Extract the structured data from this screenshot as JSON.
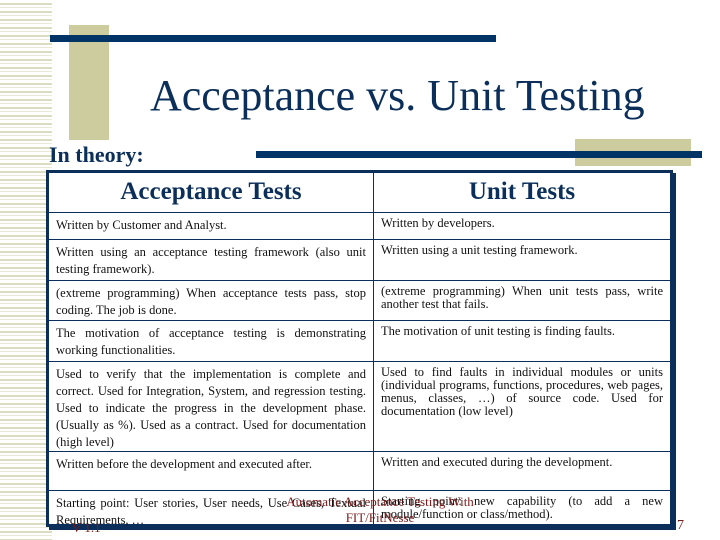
{
  "slide": {
    "title": "Acceptance vs. Unit Testing",
    "subtitle": "In theory:",
    "footer": {
      "center_line1": "Automatic Acceptance Testing With",
      "center_line2": "FIT/FitNesse",
      "left": "V 1.1",
      "page_number": "7"
    },
    "colors": {
      "navy": "#0b2f5a",
      "olive": "#cccc9e",
      "footer_text": "#7a1a1a"
    }
  },
  "table": {
    "headers": [
      "Acceptance Tests",
      "Unit Tests"
    ],
    "rows": [
      [
        "Written by Customer and Analyst.",
        "Written by developers."
      ],
      [
        "Written using an acceptance testing framework (also unit testing framework).",
        "Written using a unit testing framework."
      ],
      [
        "(extreme programming) When acceptance tests pass, stop coding. The job is done.",
        "(extreme programming) When unit tests pass, write another test that fails."
      ],
      [
        "The motivation of acceptance testing is demonstrating working functionalities.",
        "The motivation of  unit testing is finding faults."
      ],
      [
        "Used to verify that the implementation is complete and correct. Used for Integration, System, and regression testing. Used to indicate the progress in the development phase. (Usually as %). Used as a contract. Used for documentation (high level)",
        "Used to find faults in individual modules or units (individual programs, functions, procedures, web pages, menus, classes, …) of source code. Used for documentation (low level)"
      ],
      [
        "Written before the development and executed after.",
        "Written and executed during the development."
      ],
      [
        "Starting point: User stories, User needs, Use Cases, Textual Requirements, …",
        "Starting point: new capability (to add a new module/function or class/method)."
      ]
    ]
  }
}
